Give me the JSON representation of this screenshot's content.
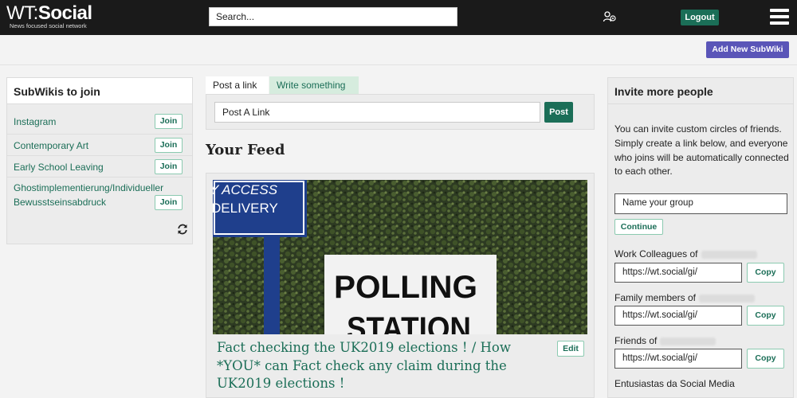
{
  "header": {
    "logo_wt": "WT:",
    "logo_social": "Social",
    "tagline": "News focused social network",
    "search_value": "Search...",
    "logout_label": "Logout"
  },
  "subbar": {
    "add_subwiki_label": "Add New SubWiki"
  },
  "subwikis": {
    "title": "SubWikis to join",
    "join_label": "Join",
    "items": [
      {
        "label": "Instagram"
      },
      {
        "label": "Contemporary Art"
      },
      {
        "label": "Early School Leaving"
      },
      {
        "label": "Ghostimplementierung/Individueller Bewusstseinsabdruck"
      }
    ]
  },
  "composer": {
    "tab_post_link": "Post a link",
    "tab_write": "Write something",
    "input_value": "Post A Link",
    "post_label": "Post"
  },
  "feed": {
    "title": "Your Feed",
    "post": {
      "title": "Fact checking the UK2019 elections ! / How *YOU* can Fact check any claim during the UK2019 elections !",
      "edit_label": "Edit",
      "image_sign_top_1": "Y ACCESS",
      "image_sign_top_2": "DELIVERY",
      "image_sign_main_1": "POLLING",
      "image_sign_main_2": "STATION"
    }
  },
  "invite": {
    "title": "Invite more people",
    "description": "You can invite custom circles of friends. Simply create a link below, and everyone who joins will be automatically connected to each other.",
    "group_placeholder": "Name your group",
    "continue_label": "Continue",
    "copy_label": "Copy",
    "circles": [
      {
        "label": "Work Colleagues of",
        "link": "https://wt.social/gi/"
      },
      {
        "label": "Family members of",
        "link": "https://wt.social/gi/"
      },
      {
        "label": "Friends of",
        "link": "https://wt.social/gi/"
      },
      {
        "label": "Entusiastas da Social Media",
        "link": ""
      }
    ]
  },
  "colors": {
    "brand_green": "#1b6e57",
    "topbar": "#1a1a1a",
    "add_subwiki": "#5a55b8"
  }
}
